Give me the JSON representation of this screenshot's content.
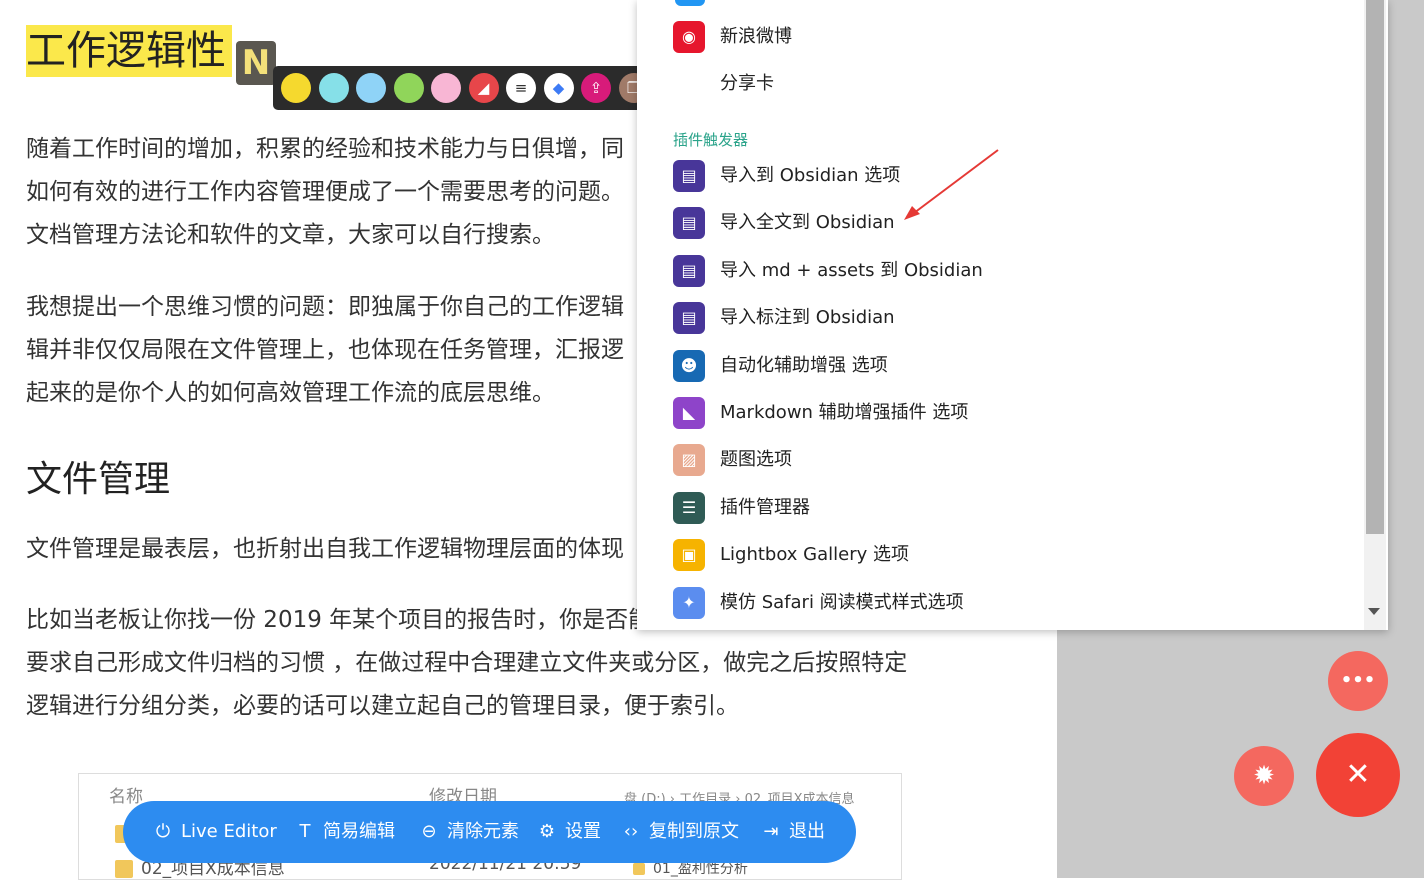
{
  "article": {
    "title": "工作逻辑性",
    "badge": "N",
    "p1": "随着工作时间的增加，积累的经验和技术能力与日俱增，同\n如何有效的进行工作内容管理便成了一个需要思考的问题。\n文档管理方法论和软件的文章，大家可以自行搜索。",
    "p2": "我想提出一个思维习惯的问题：即独属于你自己的工作逻辑\n辑并非仅仅局限在文件管理上，也体现在任务管理，汇报逻\n起来的是你个人的如何高效管理工作流的底层思维。",
    "h2": "文件管理",
    "p3": "文件管理是最表层，也折射出自我工作逻辑物理层面的体现",
    "p4": "比如当老板让你找一份 2019 年某个项目的报告时，你是否能快速定位并进行回复？这\n要求自己形成文件归档的习惯 ，在做过程中合理建立文件夹或分区，做完之后按照特定\n逻辑进行分组分类，必要的话可以建立起自己的管理目录，便于索引。"
  },
  "highlight_bar": {
    "colors": [
      "#f5d92e",
      "#86e0e8",
      "#8fd3f7",
      "#90d55a",
      "#f8b6d4"
    ],
    "tools": [
      {
        "icon": "eraser-icon",
        "glyph": "◢",
        "color": "#e7464a"
      },
      {
        "icon": "note-icon",
        "glyph": "≡",
        "color": "#ffffff"
      },
      {
        "icon": "tag-icon",
        "glyph": "◆",
        "color": "#ffffff"
      },
      {
        "icon": "upload-icon",
        "glyph": "⇪",
        "color": "#d81b7a"
      },
      {
        "icon": "copy-icon",
        "glyph": "❐",
        "color": "#a07a68"
      },
      {
        "icon": "link-icon",
        "glyph": "∞",
        "color": "#8a3ffc"
      },
      {
        "icon": "close-icon",
        "glyph": "✕",
        "color": "#e53935"
      }
    ]
  },
  "menu": {
    "items_top": [
      {
        "label": "新浪微博",
        "icon": "weibo-icon",
        "color": "#e6162d",
        "glyph": "◉"
      },
      {
        "label": "分享卡",
        "icon": "share-card-icon",
        "color": "#ffffff",
        "glyph": ""
      }
    ],
    "section_title": "插件触发器",
    "items": [
      {
        "label": "导入到 Obsidian 选项",
        "icon": "obsidian-icon",
        "color": "#483699",
        "glyph": "▤"
      },
      {
        "label": "导入全文到 Obsidian",
        "icon": "obsidian-icon",
        "color": "#483699",
        "glyph": "▤"
      },
      {
        "label": "导入 md + assets 到 Obsidian",
        "icon": "obsidian-icon",
        "color": "#483699",
        "glyph": "▤"
      },
      {
        "label": "导入标注到 Obsidian",
        "icon": "obsidian-icon",
        "color": "#483699",
        "glyph": "▤"
      },
      {
        "label": "自动化辅助增强 选项",
        "icon": "robot-icon",
        "color": "#1769b3",
        "glyph": "☻"
      },
      {
        "label": "Markdown 辅助增强插件 选项",
        "icon": "markdown-icon",
        "color": "#8e44c9",
        "glyph": "◣"
      },
      {
        "label": "题图选项",
        "icon": "image-icon",
        "color": "#e8a98f",
        "glyph": "▨"
      },
      {
        "label": "插件管理器",
        "icon": "list-icon",
        "color": "#2f5b55",
        "glyph": "☰"
      },
      {
        "label": "Lightbox Gallery 选项",
        "icon": "gallery-icon",
        "color": "#f6b300",
        "glyph": "▣"
      },
      {
        "label": "模仿 Safari 阅读模式样式选项",
        "icon": "compass-icon",
        "color": "#5b8def",
        "glyph": "✦"
      }
    ]
  },
  "fabs": {
    "more_glyph": "•••",
    "light_glyph": "✹",
    "close_glyph": "✕"
  },
  "toolbar": {
    "items": [
      {
        "label": "Live Editor",
        "icon": "power-icon",
        "glyph": "⏻"
      },
      {
        "label": "简易编辑",
        "icon": "text-edit-icon",
        "glyph": "T"
      },
      {
        "label": "清除元素",
        "icon": "remove-icon",
        "glyph": "⊖"
      },
      {
        "label": "设置",
        "icon": "settings-icon",
        "glyph": "⚙"
      },
      {
        "label": "复制到原文",
        "icon": "code-icon",
        "glyph": "‹›"
      },
      {
        "label": "退出",
        "icon": "exit-icon",
        "glyph": "⇥"
      }
    ]
  },
  "explorer": {
    "col_name": "名称",
    "col_date": "修改日期",
    "path": "盘 (D:)  ›  工作目录  ›  02_项目X成本信息",
    "row2_name": "02_项目X成本信息",
    "row2_date": "2022/11/21 20:59",
    "row2_right": "01_盈利性分析"
  }
}
